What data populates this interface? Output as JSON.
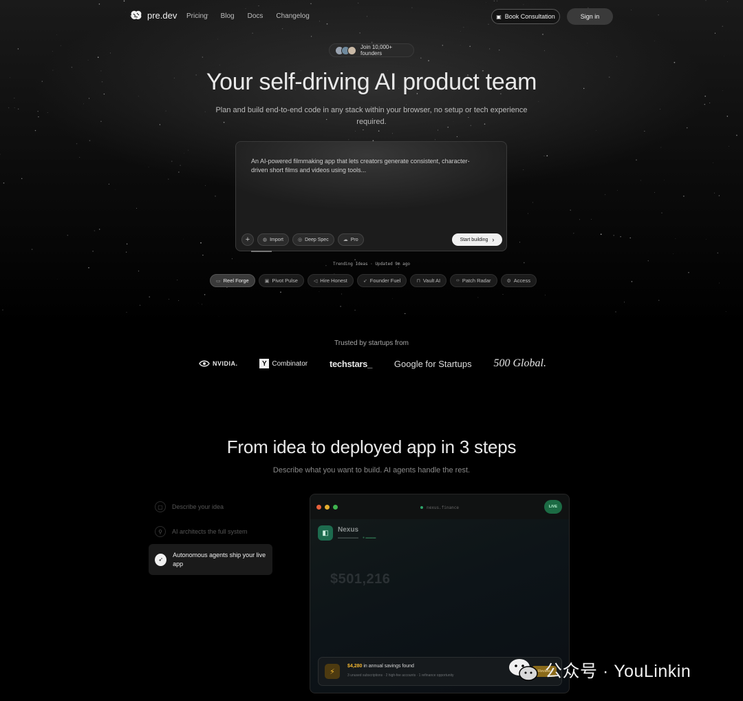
{
  "nav": {
    "brand": "pre.dev",
    "links": [
      "Pricing",
      "Blog",
      "Docs",
      "Changelog"
    ],
    "consult_label": "Book Consultation",
    "signin_label": "Sign in"
  },
  "hero": {
    "badge": "Join 10,000+ founders",
    "title": "Your self-driving AI product team",
    "subtitle": "Plan and build end-to-end code in any stack within your browser, no setup or tech experience required."
  },
  "prompt": {
    "text": "An AI-powered filmmaking app that lets creators generate consistent, character-driven short films and videos using tools...",
    "tools": [
      {
        "icon": "github-icon",
        "label": "Import"
      },
      {
        "icon": "spec-icon",
        "label": "Deep Spec"
      },
      {
        "icon": "cloud-icon",
        "label": "Pro"
      }
    ],
    "start_label": "Start building"
  },
  "trending": {
    "label": "Trending Ideas · Updated 9m ago",
    "chips": [
      {
        "icon": "video-icon",
        "label": "Reel Forge",
        "active": true
      },
      {
        "icon": "monitor-icon",
        "label": "Pivot Pulse"
      },
      {
        "icon": "megaphone-icon",
        "label": "Hire Honest"
      },
      {
        "icon": "rocket-icon",
        "label": "Founder Fuel"
      },
      {
        "icon": "lock-icon",
        "label": "Vault AI"
      },
      {
        "icon": "code-icon",
        "label": "Patch Radar"
      },
      {
        "icon": "gear-icon",
        "label": "Access"
      }
    ]
  },
  "trusted": {
    "label": "Trusted by startups from",
    "logos": [
      "NVIDIA.",
      "Combinator",
      "techstars_",
      "Google for Startups",
      "500 Global."
    ]
  },
  "steps": {
    "title": "From idea to deployed app in 3 steps",
    "subtitle": "Describe what you want to build. AI agents handle the rest.",
    "items": [
      {
        "icon": "chat-icon",
        "label": "Describe your idea",
        "active": false
      },
      {
        "icon": "network-icon",
        "label": "AI architects the full system",
        "active": false
      },
      {
        "icon": "rocket-icon",
        "label": "Autonomous agents ship your live app",
        "active": true
      }
    ]
  },
  "preview": {
    "url": "nexus.finance",
    "live": "LIVE",
    "app_name": "Nexus",
    "amount": "$501,216",
    "savings_amount": "$4,280",
    "savings_text": "in annual savings found",
    "savings_sub": "3 unused subscriptions · 2 high-fee accounts · 1 refinance opportunity",
    "review_label": "Review"
  },
  "watermark": {
    "text": "公众号 · YouLinkin"
  },
  "colors": {
    "background": "#000000",
    "accent_green": "#1c6b44",
    "accent_gold": "#f2b630"
  }
}
